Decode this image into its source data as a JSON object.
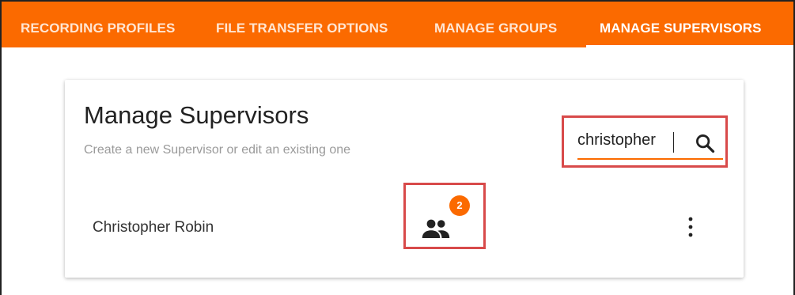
{
  "tabs": [
    {
      "label": "RECORDING PROFILES",
      "active": false
    },
    {
      "label": "FILE TRANSFER OPTIONS",
      "active": false
    },
    {
      "label": "MANAGE GROUPS",
      "active": false
    },
    {
      "label": "MANAGE SUPERVISORS",
      "active": true
    }
  ],
  "card": {
    "title": "Manage Supervisors",
    "subtitle": "Create a new Supervisor or edit an existing one"
  },
  "search": {
    "value": "christopher",
    "icon": "search-icon"
  },
  "supervisors": [
    {
      "name": "Christopher Robin",
      "groups_icon": "people-icon",
      "group_count": "2",
      "menu_icon": "more-vertical-icon"
    }
  ],
  "colors": {
    "accent": "#fb6a00",
    "highlight_border": "#d84a4a",
    "tab_text": "#ffe6d3",
    "tab_active_text": "#ffffff"
  }
}
